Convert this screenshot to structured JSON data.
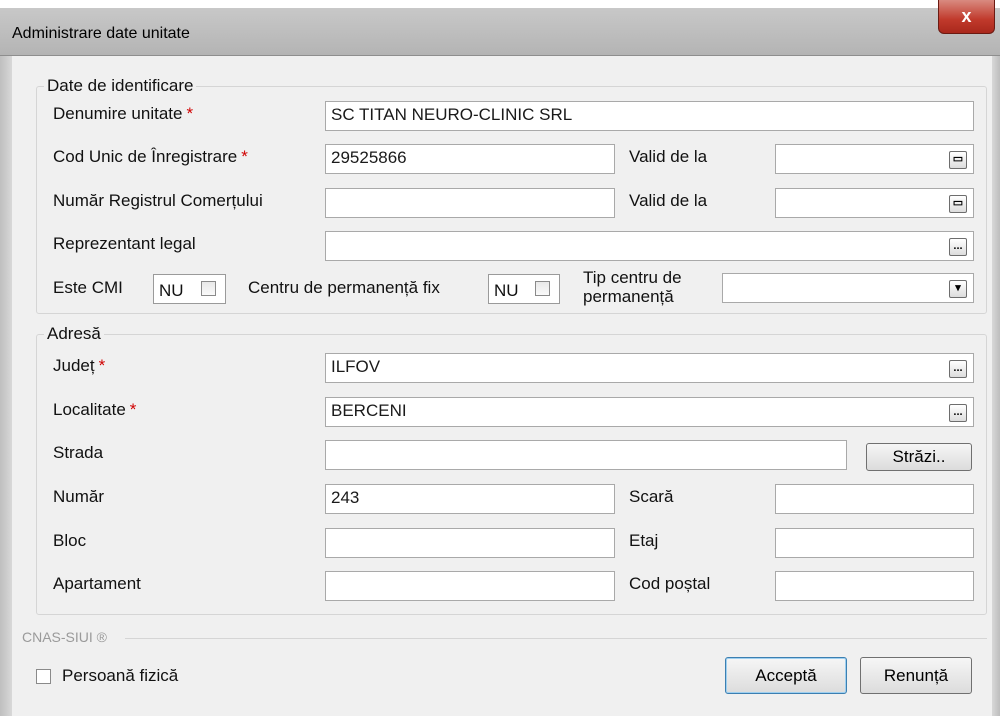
{
  "window": {
    "title": "Administrare date unitate",
    "close_glyph": "x"
  },
  "identification": {
    "legend": "Date de identificare",
    "unit_name": {
      "label": "Denumire unitate",
      "value": "SC TITAN NEURO-CLINIC SRL"
    },
    "cui": {
      "label": "Cod Unic de Înregistrare",
      "value": "29525866"
    },
    "cui_valid_from": {
      "label": "Valid de la",
      "value": ""
    },
    "trade_register": {
      "label": "Număr Registrul Comerțului",
      "value": ""
    },
    "trade_register_valid_from": {
      "label": "Valid de la",
      "value": ""
    },
    "legal_rep": {
      "label": "Reprezentant legal",
      "value": ""
    },
    "cmi": {
      "label": "Este CMI",
      "value": "NU"
    },
    "permanence_center": {
      "label": "Centru de permanență fix",
      "value": "NU"
    },
    "permanence_type": {
      "label_line1": "Tip centru de",
      "label_line2": "permanență",
      "value": ""
    }
  },
  "address": {
    "legend": "Adresă",
    "county": {
      "label": "Județ",
      "value": "ILFOV"
    },
    "locality": {
      "label": "Localitate",
      "value": "BERCENI"
    },
    "street": {
      "label": "Strada",
      "value": "",
      "button": "Străzi.."
    },
    "number": {
      "label": "Număr",
      "value": "243"
    },
    "stair": {
      "label": "Scară",
      "value": ""
    },
    "block": {
      "label": "Bloc",
      "value": ""
    },
    "floor": {
      "label": "Etaj",
      "value": ""
    },
    "apartment": {
      "label": "Apartament",
      "value": ""
    },
    "postal_code": {
      "label": "Cod poștal",
      "value": ""
    }
  },
  "footer": {
    "brand": "CNAS-SIUI ®",
    "person_label": "Persoană fizică",
    "accept_button": "Acceptă",
    "cancel_button": "Renunță"
  },
  "required_marker": "*",
  "ellipsis_glyph": "...",
  "colors": {
    "required": "#d00000",
    "close_button": "#c0392b"
  }
}
